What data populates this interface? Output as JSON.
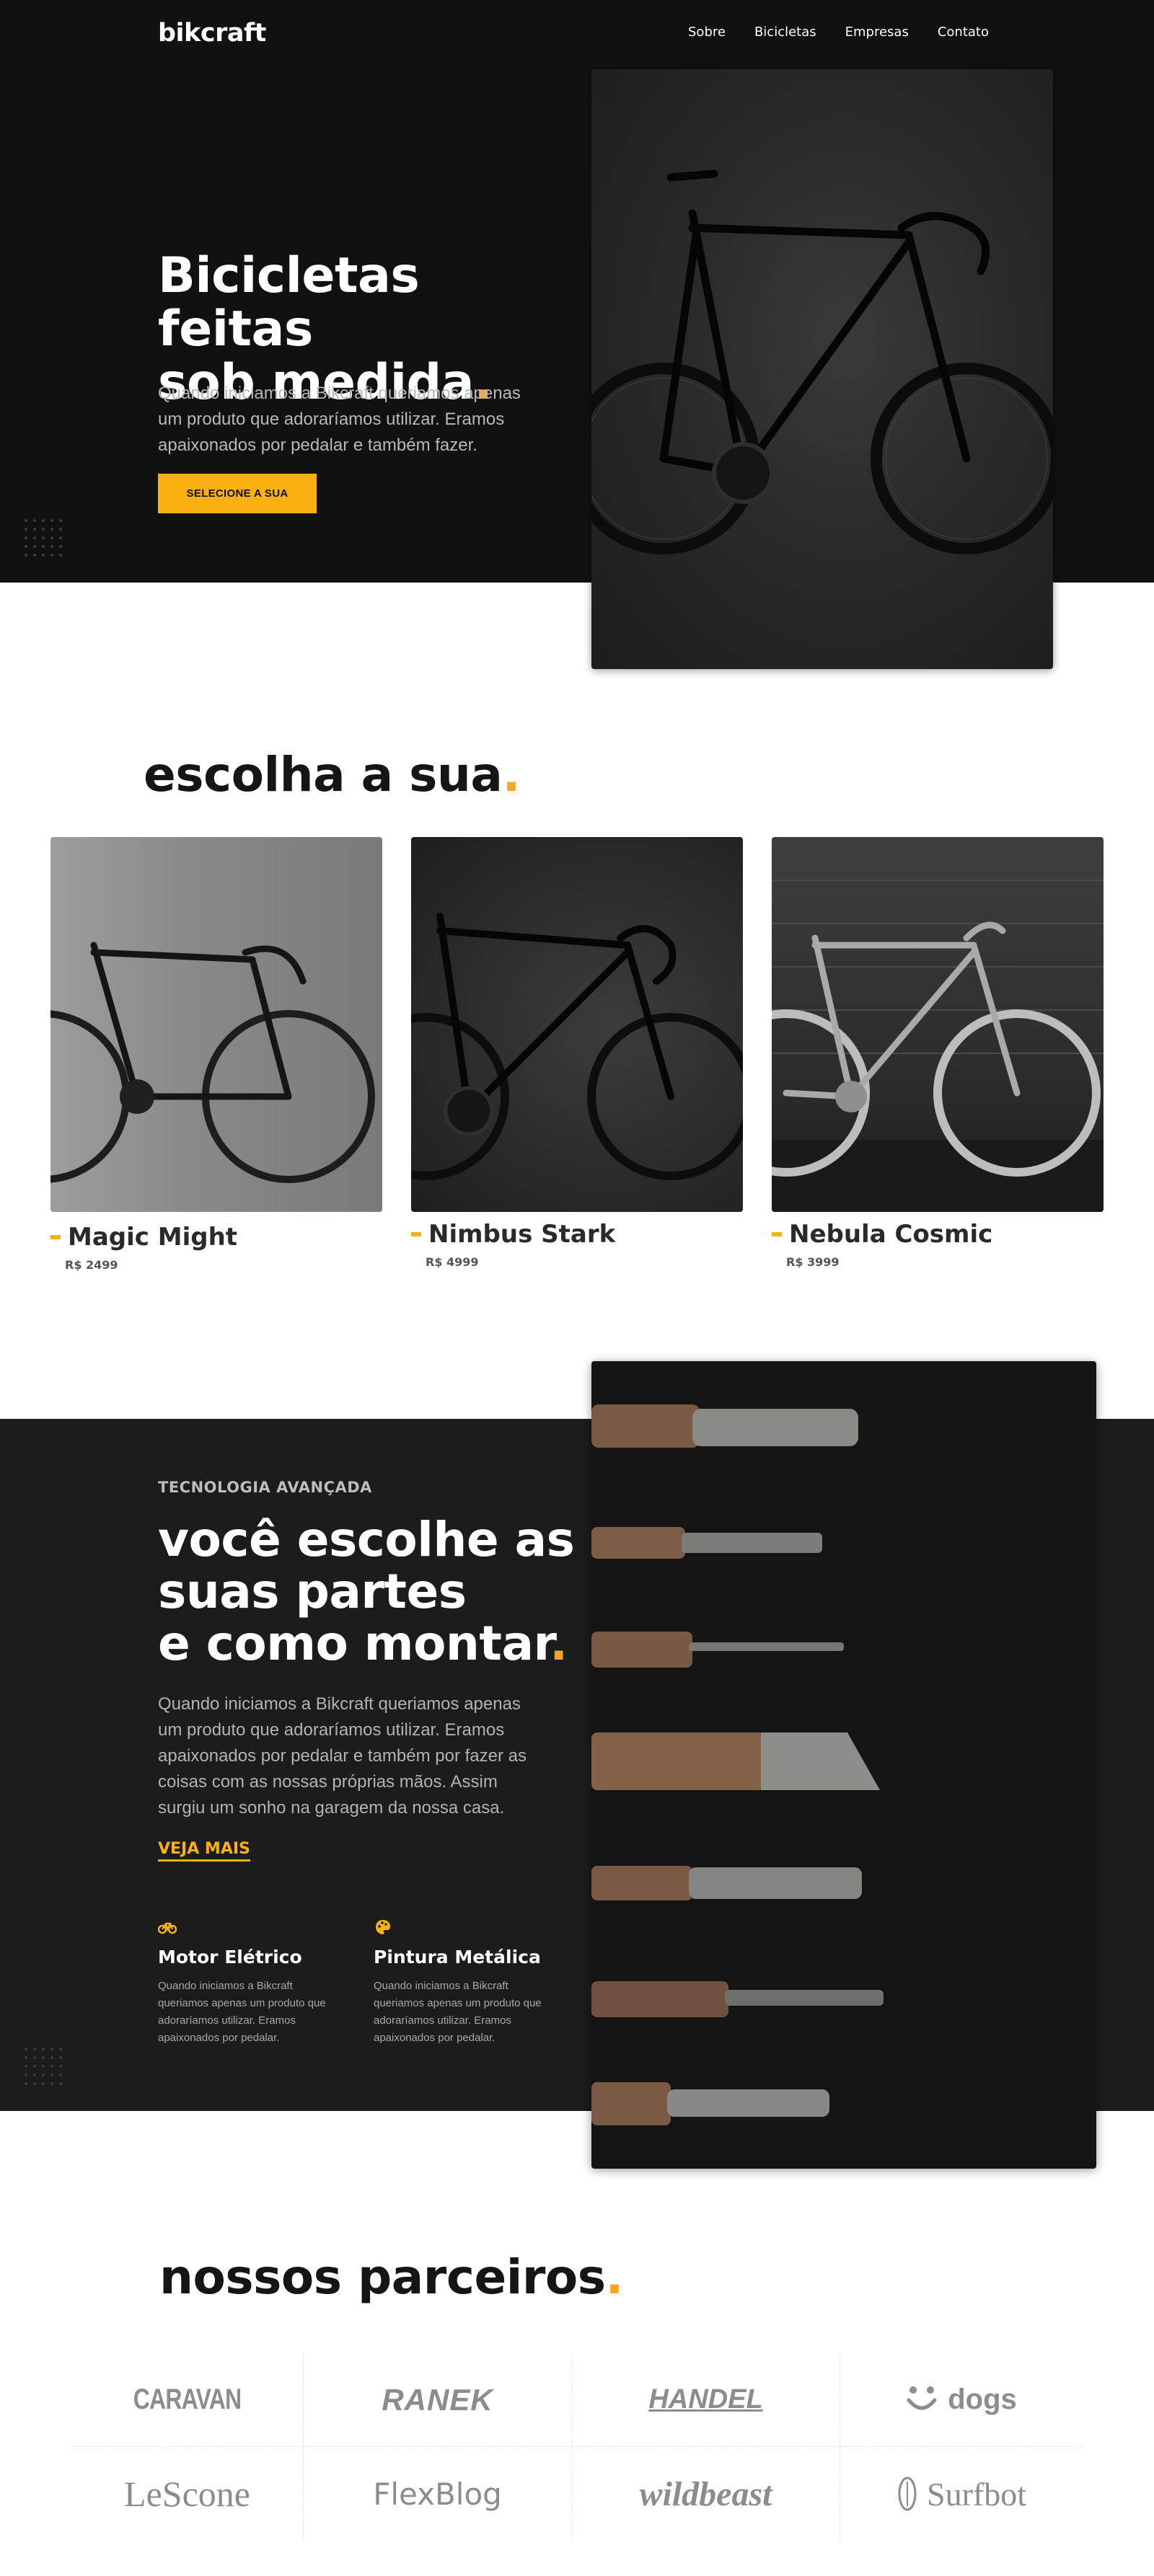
{
  "header": {
    "logo": "bikcraft",
    "nav": [
      "Sobre",
      "Bicicletas",
      "Empresas",
      "Contato"
    ]
  },
  "hero": {
    "title_line1": "Bicicletas feitas",
    "title_line2": "sob medida",
    "title_dot": ".",
    "text": "Quando iniciamos a Bikcraft queriamos apenas um produto que adoraríamos utilizar. Eramos apaixonados por pedalar e também fazer.",
    "button_label": "SELECIONE A SUA"
  },
  "escolha": {
    "title": "escolha a sua",
    "title_dot": ".",
    "bikes": [
      {
        "name": "Magic Might",
        "price": "R$ 2499"
      },
      {
        "name": "Nimbus Stark",
        "price": "R$ 4999"
      },
      {
        "name": "Nebula Cosmic",
        "price": "R$ 3999"
      }
    ]
  },
  "tecnologia": {
    "eyebrow": "TECNOLOGIA AVANÇADA",
    "title_line1": "você escolhe as",
    "title_line2": "suas partes",
    "title_line3": "e como montar",
    "title_dot": ".",
    "text": "Quando iniciamos a Bikcraft queriamos apenas um produto que adoraríamos utilizar. Eramos apaixonados por pedalar e também por fazer as coisas com as nossas próprias mãos. Assim surgiu um sonho na garagem da nossa casa.",
    "link_label": "VEJA MAIS",
    "features": [
      {
        "icon": "bike-icon",
        "title": "Motor Elétrico",
        "text": "Quando iniciamos a Bikcraft queriamos apenas um produto que adoraríamos utilizar. Eramos apaixonados por pedalar."
      },
      {
        "icon": "palette-icon",
        "title": "Pintura Metálica",
        "text": "Quando iniciamos a Bikcraft queriamos apenas um produto que adoraríamos utilizar. Eramos apaixonados por pedalar."
      }
    ]
  },
  "parceiros": {
    "title": "nossos parceiros",
    "title_dot": ".",
    "logos": [
      "CARAVAN",
      "RANEK",
      "HANDEL",
      "dogs",
      "LeScone",
      "FlexBlog",
      "wildbeast",
      "Surfbot"
    ]
  },
  "colors": {
    "accent": "#f9b111",
    "dark": "#111111",
    "dark_section": "#1c1c1c"
  }
}
